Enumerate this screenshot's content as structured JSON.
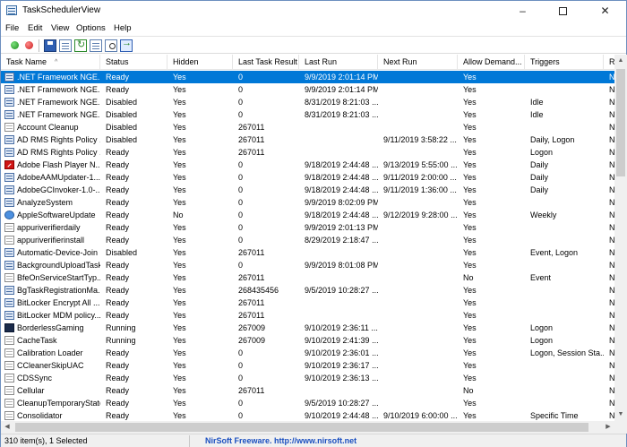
{
  "window": {
    "title": "TaskSchedulerView",
    "minimize": "–",
    "close": "✕"
  },
  "menu": [
    "File",
    "Edit",
    "View",
    "Options",
    "Help"
  ],
  "toolbar": [
    "start-green",
    "stop-red",
    "save",
    "properties",
    "refresh",
    "copy",
    "find",
    "exit"
  ],
  "columns": [
    "Task Name",
    "Status",
    "Hidden",
    "Last Task Result",
    "Last Run",
    "Next Run",
    "Allow Demand...",
    "Triggers",
    "R"
  ],
  "rows": [
    {
      "name": ".NET Framework NGE...",
      "status": "Ready",
      "hidden": "Yes",
      "result": "0",
      "last_run": "9/9/2019 2:01:14 PM",
      "next_run": "",
      "allow": "Yes",
      "triggers": "",
      "r": "N",
      "icon": "task",
      "selected": true
    },
    {
      "name": ".NET Framework NGE...",
      "status": "Ready",
      "hidden": "Yes",
      "result": "0",
      "last_run": "9/9/2019 2:01:14 PM",
      "next_run": "",
      "allow": "Yes",
      "triggers": "",
      "r": "N",
      "icon": "task"
    },
    {
      "name": ".NET Framework NGE...",
      "status": "Disabled",
      "hidden": "Yes",
      "result": "0",
      "last_run": "8/31/2019 8:21:03 ...",
      "next_run": "",
      "allow": "Yes",
      "triggers": "Idle",
      "r": "N",
      "icon": "task"
    },
    {
      "name": ".NET Framework NGE...",
      "status": "Disabled",
      "hidden": "Yes",
      "result": "0",
      "last_run": "8/31/2019 8:21:03 ...",
      "next_run": "",
      "allow": "Yes",
      "triggers": "Idle",
      "r": "N",
      "icon": "task"
    },
    {
      "name": "Account Cleanup",
      "status": "Disabled",
      "hidden": "Yes",
      "result": "267011",
      "last_run": "",
      "next_run": "",
      "allow": "Yes",
      "triggers": "",
      "r": "N",
      "icon": "plain"
    },
    {
      "name": "AD RMS Rights Policy ...",
      "status": "Disabled",
      "hidden": "Yes",
      "result": "267011",
      "last_run": "",
      "next_run": "9/11/2019 3:58:22 ...",
      "allow": "Yes",
      "triggers": "Daily, Logon",
      "r": "N",
      "icon": "task"
    },
    {
      "name": "AD RMS Rights Policy ...",
      "status": "Ready",
      "hidden": "Yes",
      "result": "267011",
      "last_run": "",
      "next_run": "",
      "allow": "Yes",
      "triggers": "Logon",
      "r": "N",
      "icon": "task"
    },
    {
      "name": "Adobe Flash Player N...",
      "status": "Ready",
      "hidden": "Yes",
      "result": "0",
      "last_run": "9/18/2019 2:44:48 ...",
      "next_run": "9/13/2019 5:55:00 ...",
      "allow": "Yes",
      "triggers": "Daily",
      "r": "N",
      "icon": "flash"
    },
    {
      "name": "AdobeAAMUpdater-1...",
      "status": "Ready",
      "hidden": "Yes",
      "result": "0",
      "last_run": "9/18/2019 2:44:48 ...",
      "next_run": "9/11/2019 2:00:00 ...",
      "allow": "Yes",
      "triggers": "Daily",
      "r": "N",
      "icon": "task"
    },
    {
      "name": "AdobeGCInvoker-1.0-...",
      "status": "Ready",
      "hidden": "Yes",
      "result": "0",
      "last_run": "9/18/2019 2:44:48 ...",
      "next_run": "9/11/2019 1:36:00 ...",
      "allow": "Yes",
      "triggers": "Daily",
      "r": "N",
      "icon": "task"
    },
    {
      "name": "AnalyzeSystem",
      "status": "Ready",
      "hidden": "Yes",
      "result": "0",
      "last_run": "9/9/2019 8:02:09 PM",
      "next_run": "",
      "allow": "Yes",
      "triggers": "",
      "r": "N",
      "icon": "task"
    },
    {
      "name": "AppleSoftwareUpdate",
      "status": "Ready",
      "hidden": "No",
      "result": "0",
      "last_run": "9/18/2019 2:44:48 ...",
      "next_run": "9/12/2019 9:28:00 ...",
      "allow": "Yes",
      "triggers": "Weekly",
      "r": "N",
      "icon": "apple"
    },
    {
      "name": "appuriverifierdaily",
      "status": "Ready",
      "hidden": "Yes",
      "result": "0",
      "last_run": "9/9/2019 2:01:13 PM",
      "next_run": "",
      "allow": "Yes",
      "triggers": "",
      "r": "N",
      "icon": "plain"
    },
    {
      "name": "appuriverifierinstall",
      "status": "Ready",
      "hidden": "Yes",
      "result": "0",
      "last_run": "8/29/2019 2:18:47 ...",
      "next_run": "",
      "allow": "Yes",
      "triggers": "",
      "r": "N",
      "icon": "plain"
    },
    {
      "name": "Automatic-Device-Join",
      "status": "Disabled",
      "hidden": "Yes",
      "result": "267011",
      "last_run": "",
      "next_run": "",
      "allow": "Yes",
      "triggers": "Event, Logon",
      "r": "N",
      "icon": "task"
    },
    {
      "name": "BackgroundUploadTask",
      "status": "Ready",
      "hidden": "Yes",
      "result": "0",
      "last_run": "9/9/2019 8:01:08 PM",
      "next_run": "",
      "allow": "Yes",
      "triggers": "",
      "r": "N",
      "icon": "task"
    },
    {
      "name": "BfeOnServiceStartTyp...",
      "status": "Ready",
      "hidden": "Yes",
      "result": "267011",
      "last_run": "",
      "next_run": "",
      "allow": "No",
      "triggers": "Event",
      "r": "N",
      "icon": "plain"
    },
    {
      "name": "BgTaskRegistrationMa...",
      "status": "Ready",
      "hidden": "Yes",
      "result": "268435456",
      "last_run": "9/5/2019 10:28:27 ...",
      "next_run": "",
      "allow": "Yes",
      "triggers": "",
      "r": "N",
      "icon": "task"
    },
    {
      "name": "BitLocker Encrypt All ...",
      "status": "Ready",
      "hidden": "Yes",
      "result": "267011",
      "last_run": "",
      "next_run": "",
      "allow": "Yes",
      "triggers": "",
      "r": "N",
      "icon": "task"
    },
    {
      "name": "BitLocker MDM policy...",
      "status": "Ready",
      "hidden": "Yes",
      "result": "267011",
      "last_run": "",
      "next_run": "",
      "allow": "Yes",
      "triggers": "",
      "r": "N",
      "icon": "task"
    },
    {
      "name": "BorderlessGaming",
      "status": "Running",
      "hidden": "Yes",
      "result": "267009",
      "last_run": "9/10/2019 2:36:11 ...",
      "next_run": "",
      "allow": "Yes",
      "triggers": "Logon",
      "r": "N",
      "icon": "bg"
    },
    {
      "name": "CacheTask",
      "status": "Running",
      "hidden": "Yes",
      "result": "267009",
      "last_run": "9/10/2019 2:41:39 ...",
      "next_run": "",
      "allow": "Yes",
      "triggers": "Logon",
      "r": "N",
      "icon": "plain"
    },
    {
      "name": "Calibration Loader",
      "status": "Ready",
      "hidden": "Yes",
      "result": "0",
      "last_run": "9/10/2019 2:36:01 ...",
      "next_run": "",
      "allow": "Yes",
      "triggers": "Logon, Session Sta...",
      "r": "N",
      "icon": "plain"
    },
    {
      "name": "CCleanerSkipUAC",
      "status": "Ready",
      "hidden": "Yes",
      "result": "0",
      "last_run": "9/10/2019 2:36:17 ...",
      "next_run": "",
      "allow": "Yes",
      "triggers": "",
      "r": "N",
      "icon": "plain"
    },
    {
      "name": "CDSSync",
      "status": "Ready",
      "hidden": "Yes",
      "result": "0",
      "last_run": "9/10/2019 2:36:13 ...",
      "next_run": "",
      "allow": "Yes",
      "triggers": "",
      "r": "N",
      "icon": "plain"
    },
    {
      "name": "Cellular",
      "status": "Ready",
      "hidden": "Yes",
      "result": "267011",
      "last_run": "",
      "next_run": "",
      "allow": "No",
      "triggers": "",
      "r": "N",
      "icon": "plain"
    },
    {
      "name": "CleanupTemporaryState",
      "status": "Ready",
      "hidden": "Yes",
      "result": "0",
      "last_run": "9/5/2019 10:28:27 ...",
      "next_run": "",
      "allow": "Yes",
      "triggers": "",
      "r": "N",
      "icon": "plain"
    },
    {
      "name": "Consolidator",
      "status": "Ready",
      "hidden": "Yes",
      "result": "0",
      "last_run": "9/10/2019 2:44:48 ...",
      "next_run": "9/10/2019 6:00:00 ...",
      "allow": "Yes",
      "triggers": "Specific Time",
      "r": "N",
      "icon": "plain"
    }
  ],
  "status": {
    "count": "310 item(s), 1 Selected",
    "link": "NirSoft Freeware.  http://www.nirsoft.net"
  }
}
